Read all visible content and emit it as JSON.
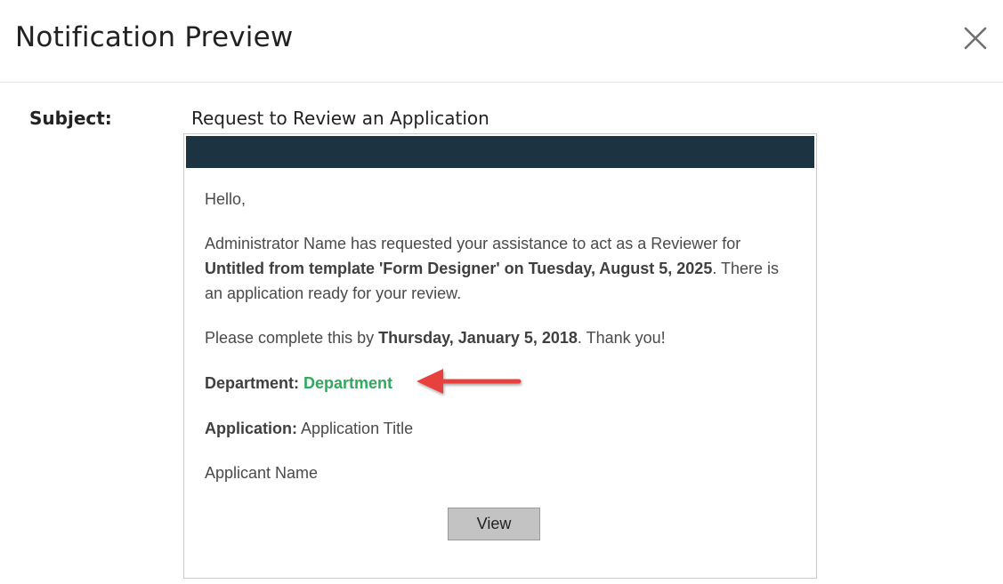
{
  "dialog": {
    "title": "Notification Preview"
  },
  "subject": {
    "label": "Subject:",
    "value": "Request to Review an Application"
  },
  "email": {
    "greeting": "Hello,",
    "request": {
      "prefix": "Administrator Name has requested your assistance to act as a Reviewer for ",
      "bold": "Untitled from template 'Form Designer' on Tuesday, August 5, 2025",
      "suffix": ". There is an application ready for your review."
    },
    "complete": {
      "prefix": "Please complete this by ",
      "date": "Thursday, January 5, 2018",
      "suffix": ". Thank you!"
    },
    "department": {
      "label": "Department:",
      "value": "Department"
    },
    "application": {
      "label": "Application:",
      "value": "Application Title"
    },
    "applicant": "Applicant Name",
    "view_button": "View"
  },
  "colors": {
    "header_bar": "#1c3342",
    "department_accent": "#2eaa5c",
    "arrow": "#e8403e",
    "button_bg": "#c3c3c3"
  },
  "icons": {
    "close": "close-icon",
    "annotation": "red-arrow-icon"
  }
}
